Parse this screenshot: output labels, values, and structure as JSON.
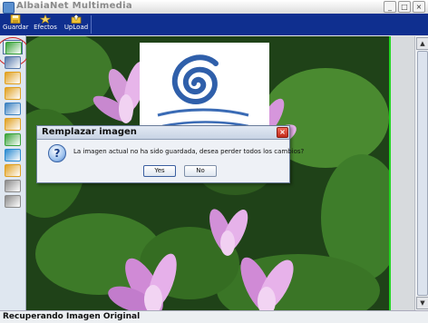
{
  "window": {
    "title": "AlbaiaNet Multimedia",
    "minimize_glyph": "_",
    "maximize_glyph": "□",
    "close_glyph": "×"
  },
  "toolbar": {
    "items": [
      {
        "label": "Guardar",
        "icon": "save-icon",
        "color": "#f2c437"
      },
      {
        "label": "Efectos",
        "icon": "effects-icon",
        "color": "#f5d46a"
      },
      {
        "label": "UpLoad",
        "icon": "upload-icon",
        "color": "#f2c437"
      }
    ]
  },
  "palette": {
    "tools": [
      {
        "icon": "image-tool-icon",
        "color": "#3aa33a"
      },
      {
        "icon": "layers-tool-icon",
        "color": "#5577aa"
      },
      {
        "icon": "rotate-tool-icon",
        "color": "#e0a020"
      },
      {
        "icon": "brush-tool-icon",
        "color": "#e0a020"
      },
      {
        "icon": "gradient-tool-icon",
        "color": "#3a80c0"
      },
      {
        "icon": "crop-tool-icon",
        "color": "#e0a020"
      },
      {
        "icon": "adjust-tool-icon",
        "color": "#3aa33a"
      },
      {
        "icon": "histogram-tool-icon",
        "color": "#2a8ad0"
      },
      {
        "icon": "zoom-tool-icon",
        "color": "#e0a020"
      },
      {
        "icon": "stamp-tool-icon",
        "color": "#8a8a8a"
      },
      {
        "icon": "shape-tool-icon",
        "color": "#8a8a8a"
      }
    ]
  },
  "dialog": {
    "title": "Remplazar imagen",
    "close_glyph": "×",
    "icon_glyph": "?",
    "message": "La imagen actual no ha sido guardada, desea perder todos los cambios?",
    "yes_label": "Yes",
    "no_label": "No"
  },
  "scrollbar": {
    "up_glyph": "▲",
    "down_glyph": "▼"
  },
  "status": {
    "text": "Recuperando Imagen Original"
  }
}
